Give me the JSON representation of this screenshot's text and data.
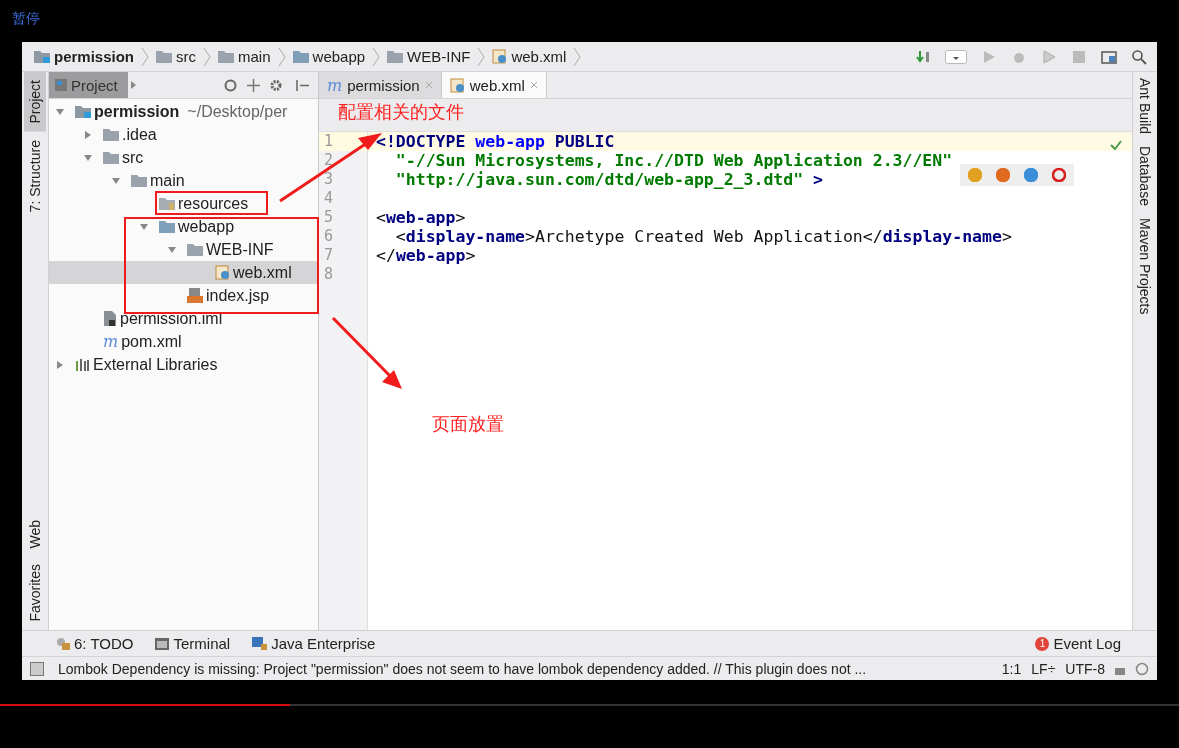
{
  "player": {
    "status": "暂停",
    "progress": {
      "level": 0.246
    }
  },
  "breadcrumbs": [
    {
      "label": "permission",
      "kind": "module",
      "bold": true
    },
    {
      "label": "src",
      "kind": "folder",
      "bold": false
    },
    {
      "label": "main",
      "kind": "folder",
      "bold": false
    },
    {
      "label": "webapp",
      "kind": "web-folder",
      "bold": false
    },
    {
      "label": "WEB-INF",
      "kind": "folder",
      "bold": false
    },
    {
      "label": "web.xml",
      "kind": "xml",
      "bold": false
    }
  ],
  "left_stripe": [
    {
      "label": "Project",
      "selected": true
    },
    {
      "label": "7: Structure",
      "selected": false
    },
    {
      "label": "Web",
      "selected": false
    },
    {
      "label": "Favorites",
      "selected": false
    }
  ],
  "right_stripe": [
    {
      "label": "Ant Build"
    },
    {
      "label": "Database"
    },
    {
      "label": "Maven Projects"
    }
  ],
  "project_panel": {
    "title": "Project",
    "tree": [
      {
        "label": "permission",
        "path": "~/Desktop/per",
        "kind": "module",
        "expanded": true,
        "selected": false,
        "children": [
          {
            "label": ".idea",
            "kind": "folder",
            "expanded": false,
            "selected": false
          },
          {
            "label": "src",
            "kind": "folder",
            "expanded": true,
            "selected": false,
            "children": [
              {
                "label": "main",
                "kind": "folder",
                "expanded": true,
                "selected": false,
                "children": [
                  {
                    "label": "resources",
                    "kind": "resources-folder",
                    "selected": false
                  },
                  {
                    "label": "webapp",
                    "kind": "web-folder",
                    "expanded": true,
                    "selected": false,
                    "children": [
                      {
                        "label": "WEB-INF",
                        "kind": "folder",
                        "expanded": true,
                        "selected": false,
                        "children": [
                          {
                            "label": "web.xml",
                            "kind": "xml",
                            "selected": true
                          }
                        ]
                      },
                      {
                        "label": "index.jsp",
                        "kind": "jsp",
                        "selected": false
                      }
                    ]
                  }
                ]
              }
            ]
          },
          {
            "label": "permission.iml",
            "kind": "iml",
            "selected": false
          },
          {
            "label": "pom.xml",
            "kind": "maven",
            "glyph": "m",
            "selected": false
          }
        ]
      },
      {
        "label": "External Libraries",
        "kind": "libraries",
        "expanded": false,
        "selected": false
      }
    ]
  },
  "editor_tabs": [
    {
      "label": "permission",
      "glyph": "m",
      "selected": false
    },
    {
      "label": "web.xml",
      "selected": true
    }
  ],
  "code_lines": [
    {
      "number": "1",
      "highlighted": true,
      "tokens": [
        {
          "kind": "keyword",
          "text": "<!DOCTYPE "
        },
        {
          "kind": "name",
          "text": "web-app"
        },
        {
          "kind": "keyword",
          "text": " PUBLIC"
        }
      ]
    },
    {
      "number": "2",
      "highlighted": false,
      "tokens": [
        {
          "kind": "string",
          "text": "  \"-//Sun Microsystems, Inc.//DTD Web Application 2.3//EN\""
        }
      ]
    },
    {
      "number": "3",
      "highlighted": false,
      "tokens": [
        {
          "kind": "string",
          "text": "  \"http://java.sun.com/dtd/web-app_2_3.dtd\""
        },
        {
          "kind": "keyword",
          "text": " >"
        }
      ]
    },
    {
      "number": "4",
      "highlighted": false
    },
    {
      "number": "5",
      "highlighted": false,
      "tokens": [
        {
          "kind": "plain",
          "text": "<"
        },
        {
          "kind": "keyword",
          "text": "web-app"
        },
        {
          "kind": "plain",
          "text": ">"
        }
      ]
    },
    {
      "number": "6",
      "highlighted": false,
      "tokens": [
        {
          "kind": "plain",
          "text": "  <"
        },
        {
          "kind": "keyword",
          "text": "display-name"
        },
        {
          "kind": "plain",
          "text": ">Archetype Created Web Application</"
        },
        {
          "kind": "keyword",
          "text": "display-name"
        },
        {
          "kind": "plain",
          "text": ">"
        }
      ]
    },
    {
      "number": "7",
      "highlighted": false,
      "tokens": [
        {
          "kind": "plain",
          "text": "</"
        },
        {
          "kind": "keyword",
          "text": "web-app"
        },
        {
          "kind": "plain",
          "text": ">"
        }
      ]
    },
    {
      "number": "8",
      "highlighted": false
    }
  ],
  "annotations": [
    {
      "text": "配置相关的文件"
    },
    {
      "text": "页面放置"
    }
  ],
  "tool_tabs": [
    {
      "label": "6: TODO",
      "kind": "todo"
    },
    {
      "label": "Terminal",
      "kind": "terminal"
    },
    {
      "label": "Java Enterprise",
      "kind": "enterprise"
    }
  ],
  "event_log": {
    "label": "Event Log",
    "badge": "1"
  },
  "status_bar": {
    "message": "Lombok Dependency is missing: Project \"permission\" does not seem to have lombok dependency added. // This plugin does not ...",
    "position": "1:1",
    "line_ending": "LF÷",
    "encoding": "UTF-8"
  }
}
